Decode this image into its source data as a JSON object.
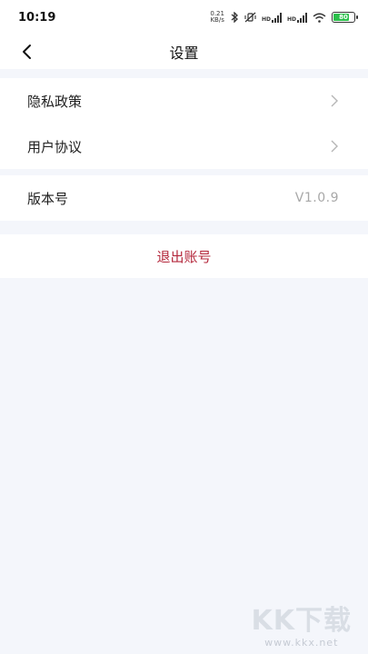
{
  "status_bar": {
    "time": "10:19",
    "net_speed_value": "0.21",
    "net_speed_unit": "KB/s",
    "signal1_label": "HD",
    "signal2_label": "HD",
    "battery_level": "80"
  },
  "nav": {
    "title": "设置"
  },
  "settings": {
    "group1": [
      {
        "label": "隐私政策"
      },
      {
        "label": "用户协议"
      }
    ],
    "version": {
      "label": "版本号",
      "value": "V1.0.9"
    },
    "logout_label": "退出账号"
  },
  "watermark": {
    "logo_text": "KK下载",
    "url": "www.kkx.net"
  },
  "colors": {
    "accent_red": "#b4283c",
    "page_bg": "#f4f6fb",
    "battery_green": "#2bc04b"
  }
}
